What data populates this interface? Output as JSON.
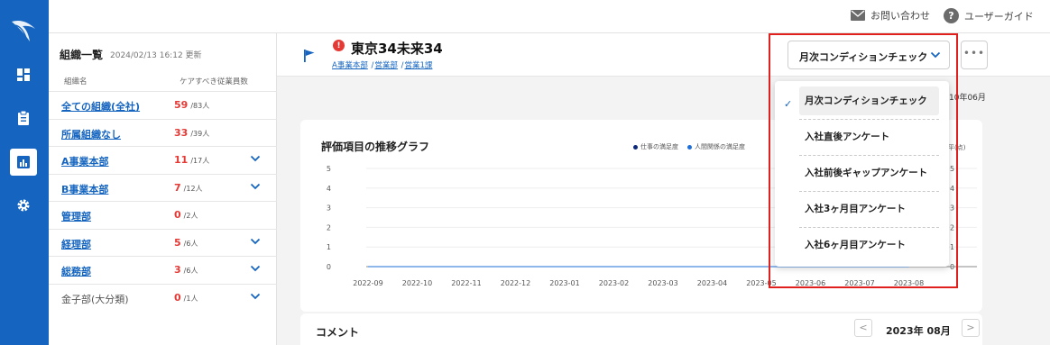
{
  "topbar": {
    "contact_label": "お問い合わせ",
    "guide_label": "ユーザーガイド"
  },
  "org_panel": {
    "title": "組織一覧",
    "updated": "2024/02/13 16:12 更新",
    "col_name": "組織名",
    "col_count": "ケアすべき従業員数",
    "rows": [
      {
        "name": "全ての組織(全社)",
        "count": "59",
        "total": "/83人",
        "expandable": false,
        "linked": true
      },
      {
        "name": "所属組織なし",
        "count": "33",
        "total": "/39人",
        "expandable": false,
        "linked": true
      },
      {
        "name": "A事業本部",
        "count": "11",
        "total": "/17人",
        "expandable": true,
        "linked": true
      },
      {
        "name": "B事業本部",
        "count": "7",
        "total": "/12人",
        "expandable": true,
        "linked": true
      },
      {
        "name": "管理部",
        "count": "0",
        "total": "/2人",
        "expandable": false,
        "linked": true
      },
      {
        "name": "経理部",
        "count": "5",
        "total": "/6人",
        "expandable": true,
        "linked": true
      },
      {
        "name": "総務部",
        "count": "3",
        "total": "/6人",
        "expandable": true,
        "linked": true
      },
      {
        "name": "金子部(大分類)",
        "count": "0",
        "total": "/1人",
        "expandable": true,
        "linked": false
      }
    ]
  },
  "page": {
    "alert_glyph": "!",
    "title": "東京34未来34",
    "breadcrumbs": [
      "A事業本部",
      "営業部",
      "営業1課"
    ],
    "breadcrumb_sep": "/",
    "survey_select_value": "月次コンディションチェック",
    "more_label": "•••",
    "month_label": "10年06月"
  },
  "chart_card": {
    "title": "評価項目の推移グラフ",
    "legend": [
      "仕事の満足度",
      "人間関係の満足度"
    ],
    "right_axis_label": "平(点)"
  },
  "chart_data": {
    "type": "line",
    "title": "評価項目の推移グラフ",
    "categories": [
      "2022-09",
      "2022-10",
      "2022-11",
      "2022-12",
      "2023-01",
      "2023-02",
      "2023-03",
      "2023-04",
      "2023-05",
      "2023-06",
      "2023-07",
      "2023-08"
    ],
    "y_ticks": [
      0,
      1,
      2,
      3,
      4,
      5
    ],
    "ylim": [
      0,
      5
    ],
    "right_y_ticks": [
      "0",
      "1",
      "2",
      "3",
      "4",
      "5"
    ],
    "series": [
      {
        "name": "仕事の満足度",
        "color": "#0d2a7a",
        "values": [
          0,
          0,
          0,
          0,
          0,
          0,
          0,
          0,
          0,
          0,
          0,
          0
        ]
      },
      {
        "name": "人間関係の満足度",
        "color": "#1e6fd9",
        "values": [
          0,
          0,
          0,
          0,
          0,
          0,
          0,
          0,
          0,
          0,
          0,
          0
        ]
      }
    ],
    "grid": true
  },
  "comment_card": {
    "title": "コメント",
    "current_month": "2023年 08月",
    "prev_label": "<",
    "next_label": ">"
  },
  "dropdown": {
    "check_glyph": "✓",
    "options": [
      "月次コンディションチェック",
      "入社直後アンケート",
      "入社前後ギャップアンケート",
      "入社3ヶ月目アンケート",
      "入社6ヶ月目アンケート"
    ],
    "selected_index": 0
  },
  "colors": {
    "rail": "#1565c0",
    "link": "#1565c0",
    "alert": "#e53935",
    "highlight": "#e0201c"
  }
}
